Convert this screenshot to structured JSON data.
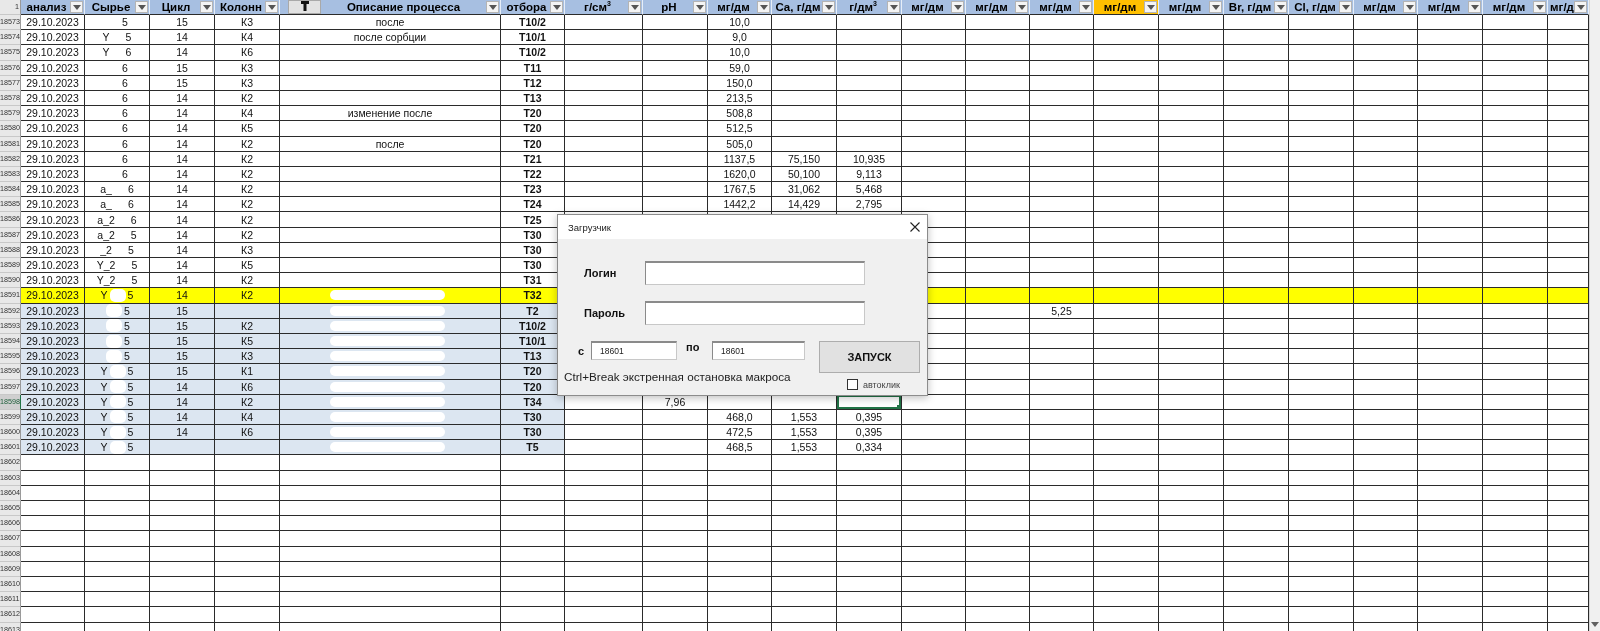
{
  "sheet": {
    "header_row_number": "1",
    "columns": [
      {
        "label": "анализ",
        "highlighted": false,
        "selected": false,
        "redacted": false,
        "sort_button": false
      },
      {
        "label": "Сырье",
        "highlighted": false,
        "selected": false,
        "redacted": true,
        "sort_button": false
      },
      {
        "label": "Цикл",
        "highlighted": false,
        "selected": false,
        "redacted": false,
        "sort_button": false
      },
      {
        "label": "Колонн",
        "highlighted": false,
        "selected": false,
        "redacted": false,
        "sort_button": false
      },
      {
        "label": "Описание процесса",
        "highlighted": false,
        "selected": false,
        "redacted": true,
        "sort_button": true
      },
      {
        "label": "отбора",
        "highlighted": false,
        "selected": false,
        "redacted": false,
        "sort_button": false
      },
      {
        "label": "г/см$^{3}$",
        "highlighted": false,
        "selected": false,
        "redacted": false,
        "sort_button": false
      },
      {
        "label": "pH",
        "highlighted": false,
        "selected": false,
        "redacted": false,
        "sort_button": false
      },
      {
        "label": "мг/дм",
        "highlighted": false,
        "selected": false,
        "redacted": false,
        "sort_button": false
      },
      {
        "label": "Ca, г/дм",
        "highlighted": false,
        "selected": false,
        "redacted": false,
        "sort_button": false
      },
      {
        "label": "г/дм$^{3}$",
        "highlighted": false,
        "selected": true,
        "redacted": false,
        "sort_button": false
      },
      {
        "label": "мг/дм",
        "highlighted": false,
        "selected": false,
        "redacted": false,
        "sort_button": false
      },
      {
        "label": "мг/дм",
        "highlighted": false,
        "selected": false,
        "redacted": false,
        "sort_button": false
      },
      {
        "label": "мг/дм",
        "highlighted": false,
        "selected": false,
        "redacted": false,
        "sort_button": false
      },
      {
        "label": "мг/дм",
        "highlighted": true,
        "selected": false,
        "redacted": false,
        "sort_button": false
      },
      {
        "label": "мг/дм",
        "highlighted": false,
        "selected": false,
        "redacted": false,
        "sort_button": false
      },
      {
        "label": "Br, г/дм",
        "highlighted": false,
        "selected": false,
        "redacted": false,
        "sort_button": false
      },
      {
        "label": "Cl, г/дм",
        "highlighted": false,
        "selected": false,
        "redacted": false,
        "sort_button": false
      },
      {
        "label": "мг/дм",
        "highlighted": false,
        "selected": false,
        "redacted": false,
        "sort_button": false
      },
      {
        "label": "мг/дм",
        "highlighted": false,
        "selected": false,
        "redacted": false,
        "sort_button": false
      },
      {
        "label": "мг/дм",
        "highlighted": false,
        "selected": false,
        "redacted": false,
        "sort_button": false
      },
      {
        "label": "мг/д",
        "highlighted": false,
        "selected": false,
        "redacted": false,
        "sort_button": false
      }
    ],
    "rows": [
      {
        "number": "18573",
        "kind": "plain",
        "selected": false,
        "cells": [
          "29.10.2023",
          [
            "5"
          ],
          "15",
          "К3",
          "после",
          "Т10/2",
          null,
          null,
          "10,0"
        ]
      },
      {
        "number": "18574",
        "kind": "plain",
        "selected": false,
        "cells": [
          "29.10.2023",
          [
            "Y",
            "5"
          ],
          "14",
          "К4",
          "после сорбции",
          "Т10/1",
          null,
          null,
          "9,0"
        ]
      },
      {
        "number": "18575",
        "kind": "plain",
        "selected": false,
        "cells": [
          "29.10.2023",
          [
            "Y",
            "6"
          ],
          "14",
          "К6",
          null,
          "Т10/2",
          null,
          null,
          "10,0"
        ]
      },
      {
        "number": "18576",
        "kind": "plain",
        "selected": false,
        "cells": [
          "29.10.2023",
          [
            "6"
          ],
          "15",
          "К3",
          null,
          "Т11",
          null,
          null,
          "59,0"
        ]
      },
      {
        "number": "18577",
        "kind": "plain",
        "selected": false,
        "cells": [
          "29.10.2023",
          [
            "6"
          ],
          "15",
          "К3",
          null,
          "Т12",
          null,
          null,
          "150,0"
        ]
      },
      {
        "number": "18578",
        "kind": "plain",
        "selected": false,
        "cells": [
          "29.10.2023",
          [
            "6"
          ],
          "14",
          "К2",
          null,
          "Т13",
          null,
          null,
          "213,5"
        ]
      },
      {
        "number": "18579",
        "kind": "plain",
        "selected": false,
        "cells": [
          "29.10.2023",
          [
            "6"
          ],
          "14",
          "К4",
          "изменение после",
          "Т20",
          null,
          null,
          "508,8"
        ]
      },
      {
        "number": "18580",
        "kind": "plain",
        "selected": false,
        "cells": [
          "29.10.2023",
          [
            "6"
          ],
          "14",
          "К5",
          null,
          "Т20",
          null,
          null,
          "512,5"
        ]
      },
      {
        "number": "18581",
        "kind": "plain",
        "selected": false,
        "cells": [
          "29.10.2023",
          [
            "6"
          ],
          "14",
          "К2",
          "после",
          "Т20",
          null,
          null,
          "505,0"
        ]
      },
      {
        "number": "18582",
        "kind": "plain",
        "selected": false,
        "cells": [
          "29.10.2023",
          [
            "6"
          ],
          "14",
          "К2",
          null,
          "Т21",
          null,
          null,
          "1137,5",
          "75,150",
          "10,935"
        ]
      },
      {
        "number": "18583",
        "kind": "plain",
        "selected": false,
        "cells": [
          "29.10.2023",
          [
            "6"
          ],
          "14",
          "К2",
          null,
          "Т22",
          null,
          null,
          "1620,0",
          "50,100",
          "9,113"
        ]
      },
      {
        "number": "18584",
        "kind": "plain",
        "selected": false,
        "cells": [
          "29.10.2023",
          [
            "a_",
            "6"
          ],
          "14",
          "К2",
          null,
          "Т23",
          null,
          null,
          "1767,5",
          "31,062",
          "5,468"
        ]
      },
      {
        "number": "18585",
        "kind": "plain",
        "selected": false,
        "cells": [
          "29.10.2023",
          [
            "a_",
            "6"
          ],
          "14",
          "К2",
          null,
          "Т24",
          null,
          null,
          "1442,2",
          "14,429",
          "2,795"
        ]
      },
      {
        "number": "18586",
        "kind": "plain",
        "selected": false,
        "cells": [
          "29.10.2023",
          [
            "a_2",
            "6"
          ],
          "14",
          "К2",
          null,
          "Т25"
        ]
      },
      {
        "number": "18587",
        "kind": "plain",
        "selected": false,
        "cells": [
          "29.10.2023",
          [
            "a_2",
            "5"
          ],
          "14",
          "К2",
          null,
          "Т30"
        ]
      },
      {
        "number": "18588",
        "kind": "plain",
        "selected": false,
        "cells": [
          "29.10.2023",
          [
            "_2",
            "5"
          ],
          "14",
          "К3",
          null,
          "Т30"
        ]
      },
      {
        "number": "18589",
        "kind": "plain",
        "selected": false,
        "cells": [
          "29.10.2023",
          [
            "Y_2",
            "5"
          ],
          "14",
          "К5",
          null,
          "Т30"
        ]
      },
      {
        "number": "18590",
        "kind": "plain",
        "selected": false,
        "cells": [
          "29.10.2023",
          [
            "Y_2",
            "5"
          ],
          "14",
          "К2",
          null,
          "Т31"
        ]
      },
      {
        "number": "18591",
        "kind": "marked",
        "selected": false,
        "cells": [
          "29.10.2023",
          [
            "Y",
            "5"
          ],
          "14",
          "К2",
          null,
          "Т32"
        ]
      },
      {
        "number": "18592",
        "kind": "grouped",
        "selected": false,
        "cells": [
          "29.10.2023",
          [
            "5"
          ],
          "15",
          null,
          null,
          "Т2",
          null,
          null,
          null,
          null,
          null,
          null,
          null,
          "5,25"
        ]
      },
      {
        "number": "18593",
        "kind": "grouped",
        "selected": false,
        "cells": [
          "29.10.2023",
          [
            "5"
          ],
          "15",
          "К2",
          null,
          "Т10/2"
        ]
      },
      {
        "number": "18594",
        "kind": "grouped",
        "selected": false,
        "cells": [
          "29.10.2023",
          [
            "5"
          ],
          "15",
          "К5",
          null,
          "Т10/1"
        ]
      },
      {
        "number": "18595",
        "kind": "grouped",
        "selected": false,
        "cells": [
          "29.10.2023",
          [
            "5"
          ],
          "15",
          "К3",
          null,
          "Т13"
        ]
      },
      {
        "number": "18596",
        "kind": "grouped",
        "selected": false,
        "cells": [
          "29.10.2023",
          [
            "Y",
            "5"
          ],
          "15",
          "К1",
          null,
          "Т20"
        ]
      },
      {
        "number": "18597",
        "kind": "grouped",
        "selected": false,
        "cells": [
          "29.10.2023",
          [
            "Y",
            "5"
          ],
          "14",
          "К6",
          null,
          "Т20"
        ]
      },
      {
        "number": "18598",
        "kind": "grouped",
        "selected": true,
        "cells": [
          "29.10.2023",
          [
            "Y",
            "5"
          ],
          "14",
          "К2",
          null,
          "Т34",
          null,
          "7,96"
        ]
      },
      {
        "number": "18599",
        "kind": "grouped",
        "selected": false,
        "cells": [
          "29.10.2023",
          [
            "Y",
            "5"
          ],
          "14",
          "К4",
          null,
          "Т30",
          null,
          null,
          "468,0",
          "1,553",
          "0,395"
        ]
      },
      {
        "number": "18600",
        "kind": "grouped",
        "selected": false,
        "cells": [
          "29.10.2023",
          [
            "Y",
            "5"
          ],
          "14",
          "К6",
          null,
          "Т30",
          null,
          null,
          "472,5",
          "1,553",
          "0,395"
        ]
      },
      {
        "number": "18601",
        "kind": "grouped",
        "selected": false,
        "cells": [
          "29.10.2023",
          [
            "Y",
            "5"
          ],
          null,
          null,
          null,
          "Т5",
          null,
          null,
          "468,5",
          "1,553",
          "0,334"
        ]
      },
      {
        "number": "18602",
        "kind": "plain",
        "selected": false
      },
      {
        "number": "18603",
        "kind": "plain",
        "selected": false
      },
      {
        "number": "18604",
        "kind": "plain",
        "selected": false
      },
      {
        "number": "18605",
        "kind": "plain",
        "selected": false
      },
      {
        "number": "18606",
        "kind": "plain",
        "selected": false
      },
      {
        "number": "18607",
        "kind": "plain",
        "selected": false
      },
      {
        "number": "18608",
        "kind": "plain",
        "selected": false
      },
      {
        "number": "18609",
        "kind": "plain",
        "selected": false
      },
      {
        "number": "18610",
        "kind": "plain",
        "selected": false
      },
      {
        "number": "18611",
        "kind": "plain",
        "selected": false
      },
      {
        "number": "18612",
        "kind": "plain",
        "selected": false
      },
      {
        "number": "18613",
        "kind": "plain",
        "selected": false
      }
    ]
  },
  "dialog": {
    "title": "Загрузчик",
    "login": {
      "label": "Логин"
    },
    "password": {
      "label": "Пароль"
    },
    "range_from": {
      "label": "с",
      "value": "18601"
    },
    "range_to": {
      "label": "по",
      "value": "18601"
    },
    "run_button": "ЗАПУСК",
    "hint": "Ctrl+Break экстренная остановка макроса",
    "autoclick": {
      "label": "автоклик",
      "checked": false
    }
  }
}
